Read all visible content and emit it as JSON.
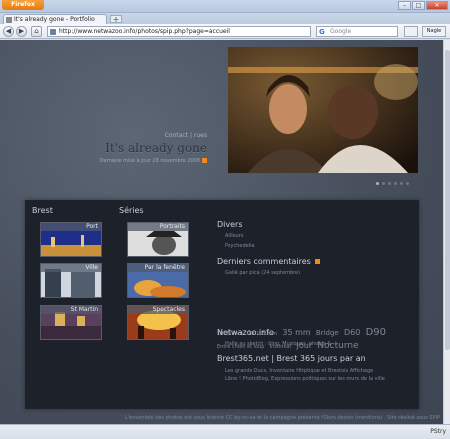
{
  "browser": {
    "app_button": "Firefox",
    "tab_title": "It's already gone - Portfolio",
    "new_tab": "+",
    "url": "http://www.netwazoo.info/photos/spip.php?page=accueil",
    "search_placeholder": "Google",
    "tools_label": "Nagle",
    "status_right": "PStry"
  },
  "header": {
    "links": "Contact | rues",
    "title": "It's already gone",
    "updated": "Derniere mise à jour 28 novembre 2008"
  },
  "columns": {
    "brest": {
      "title": "Brest",
      "items": [
        {
          "label": "Port",
          "colors": [
            "#1e2f8a",
            "#c8913a"
          ]
        },
        {
          "label": "Ville",
          "colors": [
            "#35404e",
            "#cfd6df"
          ]
        },
        {
          "label": "St Martin",
          "colors": [
            "#5b3f5e",
            "#d8b15a"
          ]
        }
      ]
    },
    "series": {
      "title": "Séries",
      "items": [
        {
          "label": "Portraits",
          "colors": [
            "#6e6e6e",
            "#ddd"
          ]
        },
        {
          "label": "Par la fenêtre",
          "colors": [
            "#4a6aa8",
            "#e7a43f"
          ]
        },
        {
          "label": "Spectacles",
          "colors": [
            "#9a3b1c",
            "#f3c24a"
          ]
        }
      ]
    }
  },
  "divers": {
    "title": "Divers",
    "items": [
      "Ailleurs",
      "Psychedelia"
    ]
  },
  "comments": {
    "title": "Derniers commentaires",
    "entry": "Gallé par pica (24 septembre)"
  },
  "tags": [
    {
      "text": "18-35 mm",
      "size": 5
    },
    {
      "text": "18-105 mm",
      "size": 5
    },
    {
      "text": "35 mm",
      "size": 8
    },
    {
      "text": "Bridge",
      "size": 7
    },
    {
      "text": "D60",
      "size": 8
    },
    {
      "text": "D90",
      "size": 10
    },
    {
      "text": "Entre chien et loup",
      "size": 5
    },
    {
      "text": "Instinkat",
      "size": 5
    },
    {
      "text": "Jour",
      "size": 8
    },
    {
      "text": "Nocturne",
      "size": 9
    }
  ],
  "netwazoo": {
    "title": "Netwazoo.info",
    "text": "Halle au sketch : blog, Musiques, photos & ..."
  },
  "brest365": {
    "title": "Brest365.net | Brest 365 jours par an",
    "text": "Les grands Ducs, Inventaire Httptique et Brestois Affichage Libre ! PhotoBlog, Expressions politiques sur les murs de la ville"
  },
  "footer": "L'ensemble des photos est sous licence CC by-nc-sa et la campagne présente l'Ours dessin (mentions) · Site réalisé sous SPIP",
  "colors": {
    "accent": "#f08a1c",
    "panel": "#1d222a",
    "page_bg": "#474f5d"
  }
}
